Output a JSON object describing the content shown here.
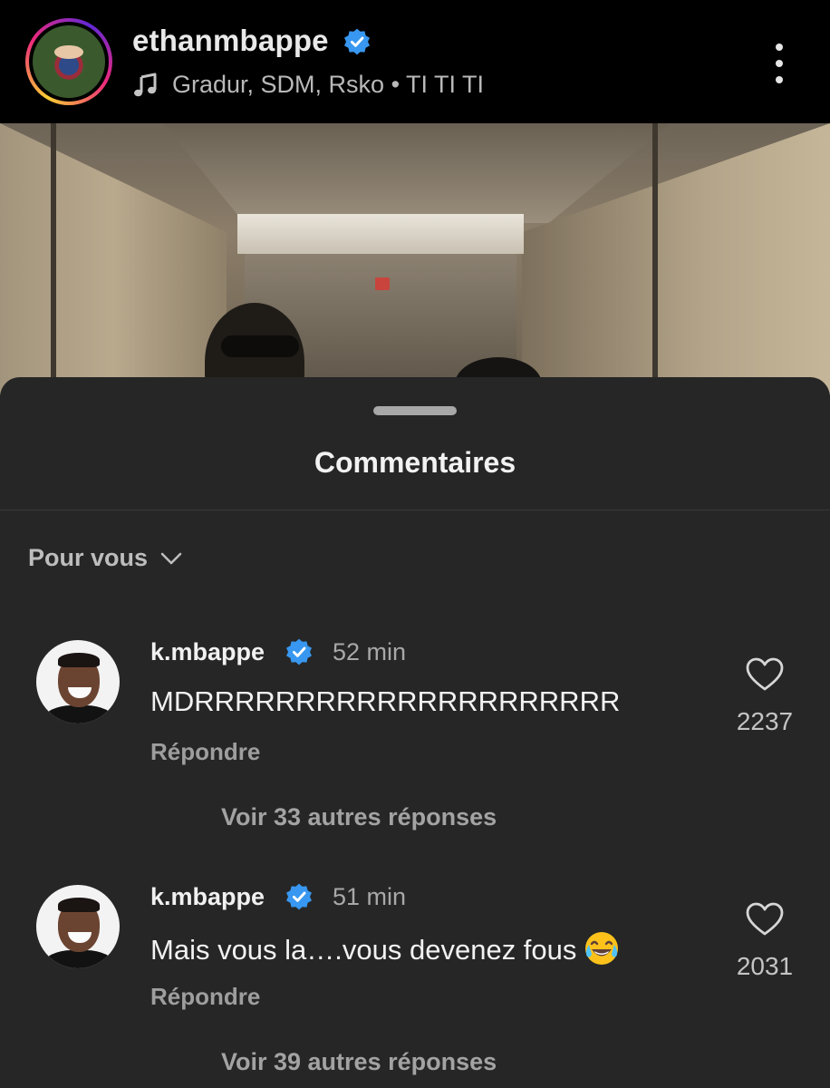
{
  "header": {
    "username": "ethanmbappe",
    "verified_icon": "verified-badge-icon",
    "music_icon": "music-note-icon",
    "music_text": "Gradur, SDM, Rsko • TI TI TI",
    "more_icon": "more-vertical-icon"
  },
  "sheet": {
    "title": "Commentaires",
    "filter_label": "Pour vous",
    "filter_icon": "chevron-down-icon"
  },
  "comments": [
    {
      "username": "k.mbappe",
      "time": "52 min",
      "text": "MDRRRRRRRRRRRRRRRRRRRRR",
      "reply_label": "Répondre",
      "like_count": "2237",
      "view_replies": "Voir 33 autres réponses"
    },
    {
      "username": "k.mbappe",
      "time": "51 min",
      "text": "Mais vous la….vous devenez fous",
      "emoji": "tears-of-joy-emoji",
      "reply_label": "Répondre",
      "like_count": "2031",
      "view_replies": "Voir 39 autres réponses"
    }
  ],
  "colors": {
    "verified": "#3897f0",
    "sheet_bg": "#262626",
    "header_bg": "#000000"
  }
}
